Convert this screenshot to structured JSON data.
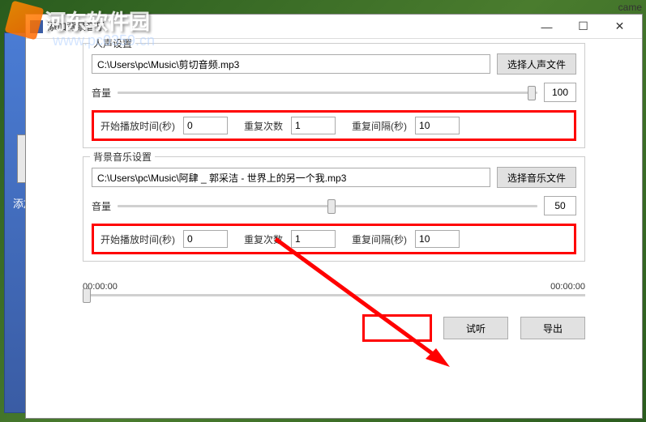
{
  "watermark": {
    "text": "河东软件园",
    "url": "www.pc0359.cn"
  },
  "came": "came",
  "bg": {
    "label": "添加背景"
  },
  "titlebar": {
    "title": "添加背景音乐"
  },
  "voice": {
    "title": "人声设置",
    "path": "C:\\Users\\pc\\Music\\剪切音频.mp3",
    "select_btn": "选择人声文件",
    "volume_label": "音量",
    "volume_value": "100",
    "start_label": "开始播放时间(秒)",
    "start_value": "0",
    "repeat_label": "重复次数",
    "repeat_value": "1",
    "interval_label": "重复间隔(秒)",
    "interval_value": "10"
  },
  "bgm": {
    "title": "背景音乐设置",
    "path": "C:\\Users\\pc\\Music\\阿肆 _ 郭采洁 - 世界上的另一个我.mp3",
    "select_btn": "选择音乐文件",
    "volume_label": "音量",
    "volume_value": "50",
    "start_label": "开始播放时间(秒)",
    "start_value": "0",
    "repeat_label": "重复次数",
    "repeat_value": "1",
    "interval_label": "重复间隔(秒)",
    "interval_value": "10"
  },
  "timeline": {
    "start": "00:00:00",
    "end": "00:00:00"
  },
  "buttons": {
    "preview": "试听",
    "export": "导出"
  }
}
